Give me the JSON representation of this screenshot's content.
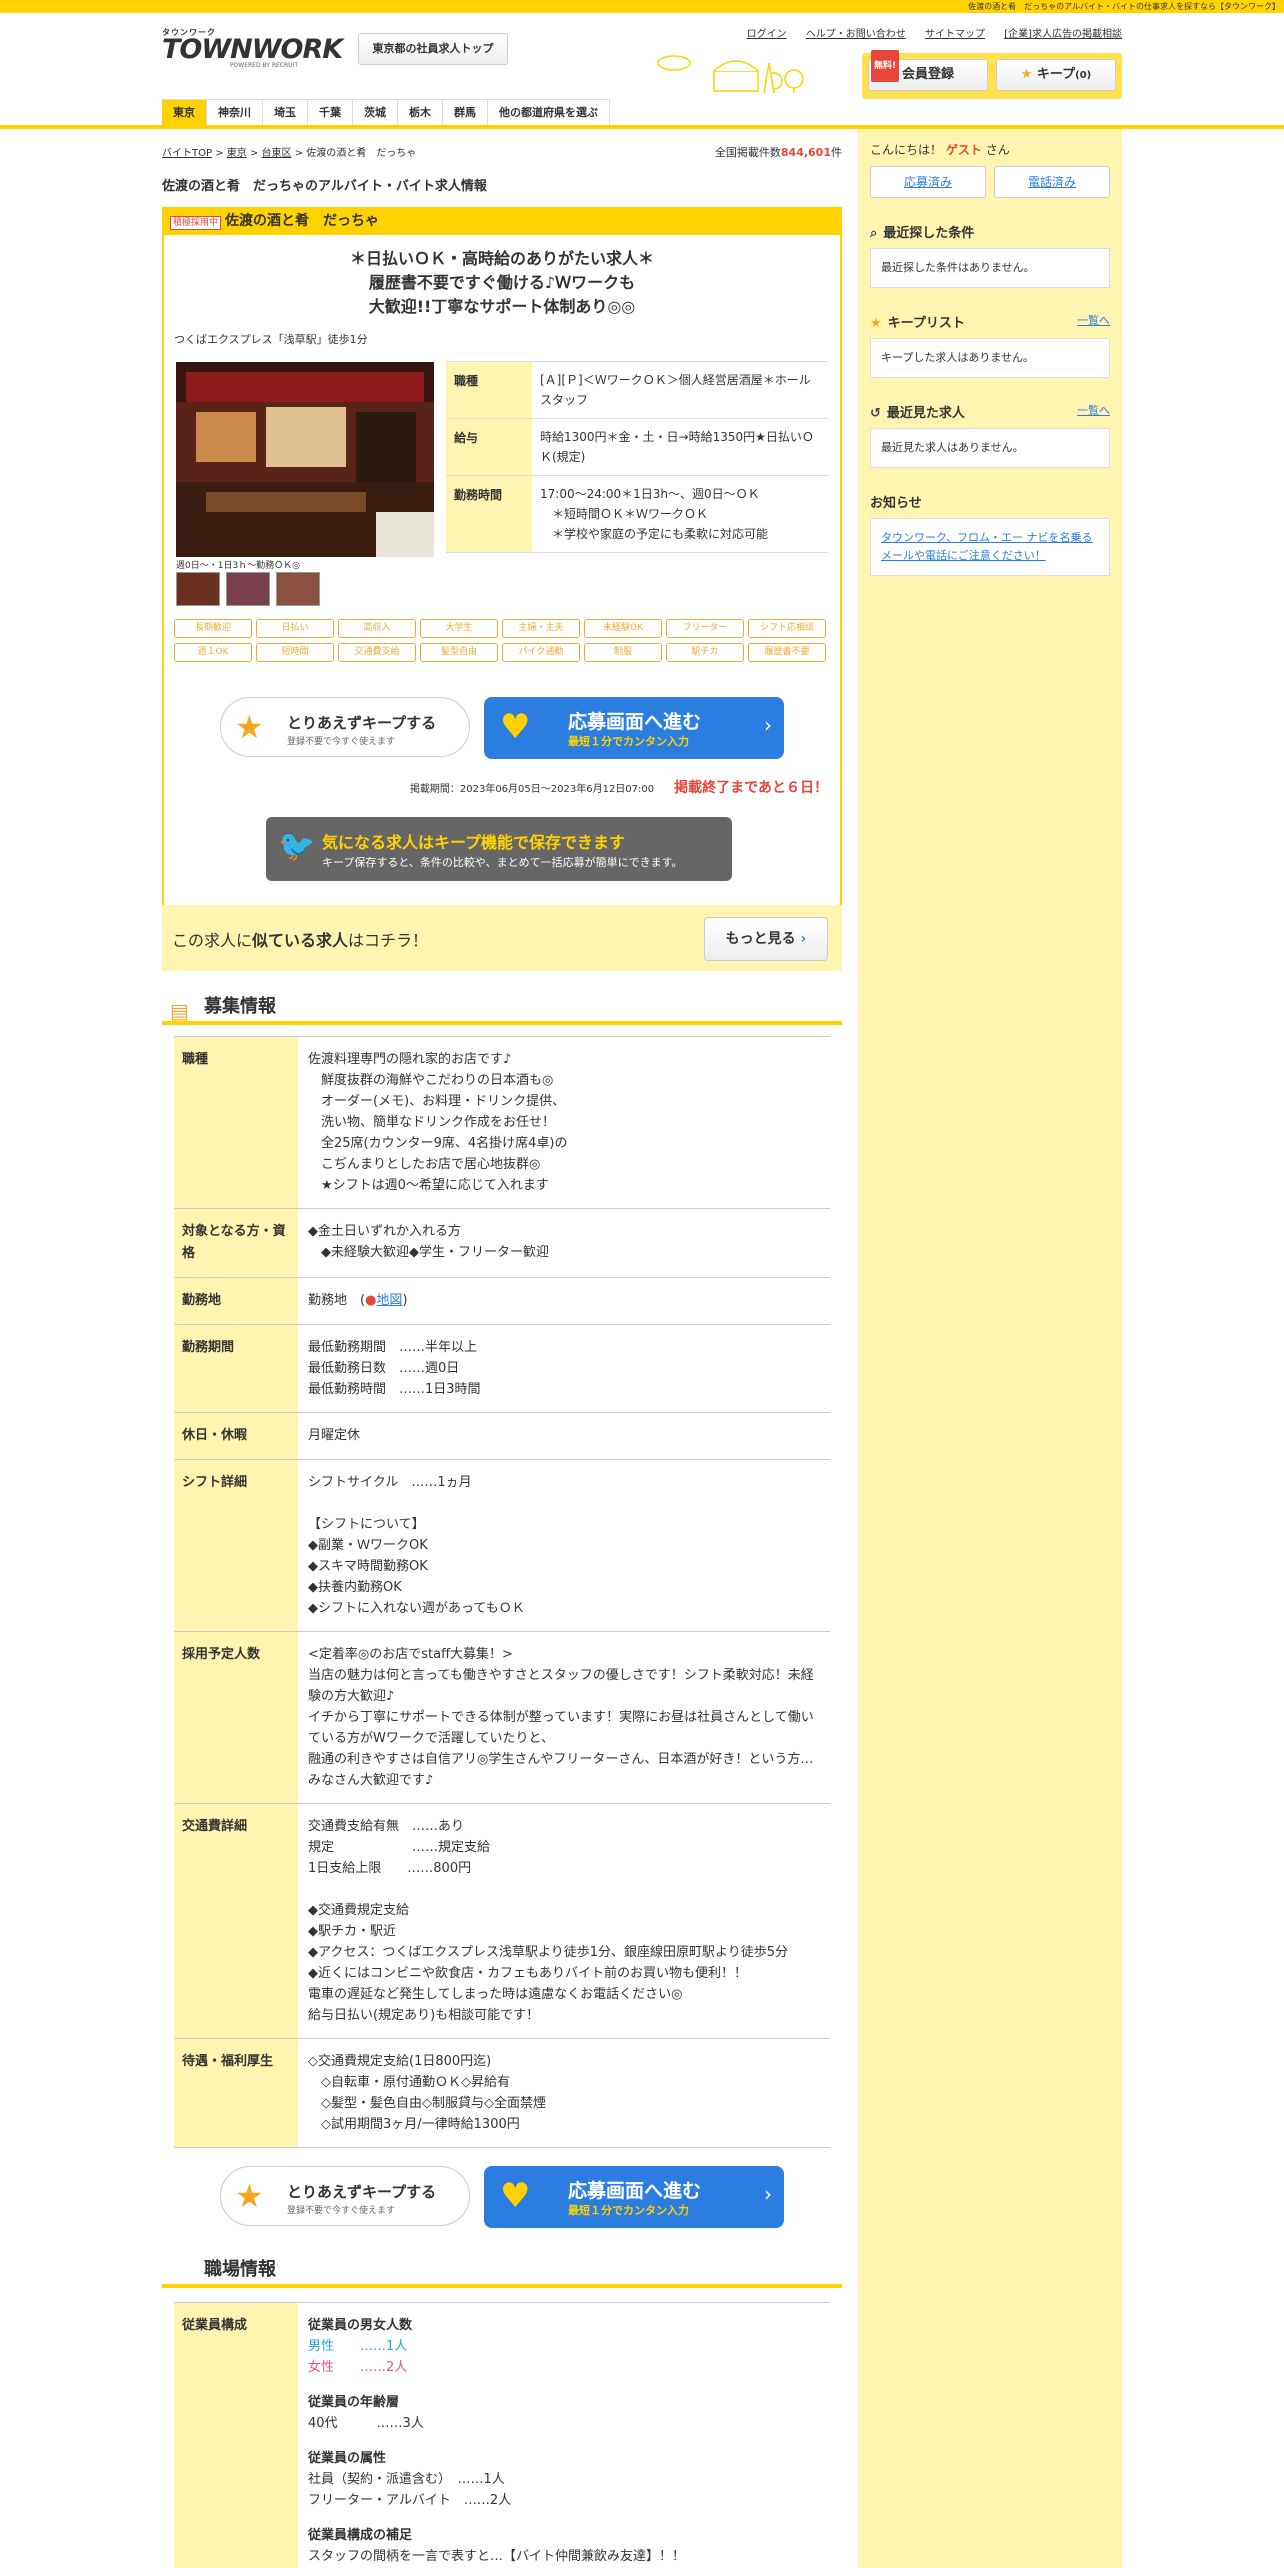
{
  "topbar": {
    "text": "佐渡の酒と肴　だっちゃのアルバイト・バイトの仕事求人を探すなら【タウンワーク】"
  },
  "logo": {
    "kana": "タウンワーク",
    "main": "TOWNWORK",
    "powered": "POWERED BY RECRUIT"
  },
  "header": {
    "top_button": "東京都の社員求人トップ",
    "links": [
      "ログイン",
      "ヘルプ・お問い合わせ",
      "サイトマップ",
      "[企業]求人広告の掲載相談"
    ],
    "free_badge": "無料!",
    "member_button": "会員登録",
    "keep_button": "キープ",
    "keep_count": "(0)"
  },
  "nav": {
    "items": [
      "東京",
      "神奈川",
      "埼玉",
      "千葉",
      "茨城",
      "栃木",
      "群馬",
      "他の都道府県を選ぶ"
    ],
    "active": 0
  },
  "breadcrumb": [
    "バイトTOP",
    "東京",
    "台東区",
    "佐渡の酒と肴　だっちゃ"
  ],
  "total_count": {
    "label": "全国掲載件数",
    "value": "844,601",
    "unit": "件"
  },
  "page_title": "佐渡の酒と肴　だっちゃのアルバイト・バイト求人情報",
  "job": {
    "tag": "積極採用中",
    "name": "佐渡の酒と肴　だっちゃ",
    "catch": [
      "＊日払いＯＫ・高時給のありがたい求人＊",
      "履歴書不要ですぐ働ける♪Ｗワークも",
      "大歓迎!!丁寧なサポート体制あり◎◎"
    ],
    "access": "つくばエクスプレス「浅草駅」徒歩1分",
    "photo_caption": "週0日～・1日3ｈ～勤務ＯＫ◎",
    "spec": [
      {
        "label": "職種",
        "value": "[Ａ][Ｐ]＜ＷワークＯＫ＞個人経営居酒屋＊ホールスタッフ"
      },
      {
        "label": "給与",
        "value": "時給1300円＊金・土・日→時給1350円★日払いＯＫ(規定)"
      },
      {
        "label": "勤務時間",
        "value": "17:00～24:00＊1日3h～、週0日～ＯＫ\n　＊短時間ＯＫ＊ＷワークＯＫ\n　＊学校や家庭の予定にも柔軟に対応可能"
      }
    ],
    "tags": [
      "長期歓迎",
      "日払い",
      "高収入",
      "大学生",
      "主婦・主夫",
      "未経験OK",
      "フリーター",
      "シフト応相談",
      "週１OK",
      "短時間",
      "交通費支給",
      "髪型自由",
      "バイク通勤",
      "制服",
      "駅チカ",
      "履歴書不要"
    ],
    "keep": {
      "label": "とりあえずキープする",
      "sub": "登録不要で今すぐ使えます"
    },
    "apply": {
      "label": "応募画面へ進む",
      "sub": "最短１分でカンタン入力"
    },
    "period": "掲載期間：2023年06月05日～2023年6月12日07:00",
    "remaining": "掲載終了まであと６日！",
    "keepinfo": {
      "title": "気になる求人はキープ機能で保存できます",
      "sub": "キープ保存すると、条件の比較や、まとめて一括応募が簡単にできます。"
    },
    "similar": {
      "text_a": "この求人に",
      "text_b": "似ている求人",
      "text_c": "はコチラ！",
      "button": "もっと見る"
    }
  },
  "recruit": {
    "title": "募集情報",
    "rows": [
      {
        "label": "職種",
        "value": "佐渡料理専門の隠れ家的お店です♪\n　鮮度抜群の海鮮やこだわりの日本酒も◎\n　オーダー(メモ)、お料理・ドリンク提供、\n　洗い物、簡単なドリンク作成をお任せ！\n　全25席(カウンター9席、4名掛け席4卓)の\n　こぢんまりとしたお店で居心地抜群◎\n　★シフトは週0～希望に応じて入れます"
      },
      {
        "label": "対象となる方・資格",
        "value": "◆金土日いずれか入れる方\n　◆未経験大歓迎◆学生・フリーター歓迎"
      },
      {
        "label": "勤務地",
        "value": "勤務地　(",
        "map": "地図",
        "tail": ")"
      },
      {
        "label": "勤務期間",
        "value": "最低勤務期間　……半年以上\n最低勤務日数　……週0日\n最低勤務時間　……1日3時間"
      },
      {
        "label": "休日・休暇",
        "value": "月曜定休"
      },
      {
        "label": "シフト詳細",
        "value": "シフトサイクル　……1ヵ月\n\n【シフトについて】\n◆副業・ＷワークOK\n◆スキマ時間勤務OK\n◆扶養内勤務OK\n◆シフトに入れない週があってもＯＫ"
      },
      {
        "label": "採用予定人数",
        "value": "<定着率◎のお店でstaff大募集！>\n当店の魅力は何と言っても働きやすさとスタッフの優しさです！シフト柔軟対応！未経験の方大歓迎♪\nイチから丁寧にサポートできる体制が整っています！実際にお昼は社員さんとして働いている方がWワークで活躍していたりと、\n融通の利きやすさは自信アリ◎学生さんやフリーターさん、日本酒が好き！という方…みなさん大歓迎です♪"
      },
      {
        "label": "交通費詳細",
        "value": "交通費支給有無　……あり\n規定　　　　　　……規定支給\n1日支給上限　　……800円\n\n◆交通費規定支給\n◆駅チカ・駅近\n◆アクセス：つくばエクスプレス浅草駅より徒歩1分、銀座線田原町駅より徒歩5分\n◆近くにはコンビニや飲食店・カフェもありバイト前のお買い物も便利！！\n電車の遅延など発生してしまった時は遠慮なくお電話ください◎\n給与日払い(規定あり)も相談可能です！"
      },
      {
        "label": "待遇・福利厚生",
        "value": "◇交通費規定支給(1日800円迄)\n　◇自転車・原付通勤ＯＫ◇昇給有\n　◇髪型・髪色自由◇制服貸与◇全面禁煙\n　◇試用期間3ヶ月/一律時給1300円"
      }
    ]
  },
  "workplace": {
    "title": "職場情報",
    "label": "従業員構成",
    "gender_title": "従業員の男女人数",
    "male": "男性　　……1人",
    "female": "女性　　……2人",
    "age_title": "従業員の年齢層",
    "age": "40代　　　……3人",
    "attr_title": "従業員の属性",
    "attr1": "社員（契約・派遣含む）　……1人",
    "attr2": "フリーター・アルバイト　……2人",
    "note_title": "従業員構成の補足",
    "note": "スタッフの間柄を一言で表すと…【バイト仲間兼飲み友達】！！\n仕事中は何でも質問できる頼もしい先輩。仕事外でも楽しく話せる雰囲気◎のス"
  },
  "side": {
    "hello_a": "こんにちは！",
    "guest": "ゲスト",
    "hello_b": "さん",
    "btn_applied": "応募済み",
    "btn_called": "電話済み",
    "recent_search": {
      "title": "最近探した条件",
      "empty": "最近探した条件はありません。"
    },
    "keep_list": {
      "title": "キープリスト",
      "link": "一覧へ",
      "empty": "キープした求人はありません。"
    },
    "recent_view": {
      "title": "最近見た求人",
      "link": "一覧へ",
      "empty": "最近見た求人はありません。"
    },
    "notice": {
      "title": "お知らせ",
      "text": "タウンワーク、フロム・エー ナビを名乗るメールや電話にご注意ください！"
    }
  }
}
